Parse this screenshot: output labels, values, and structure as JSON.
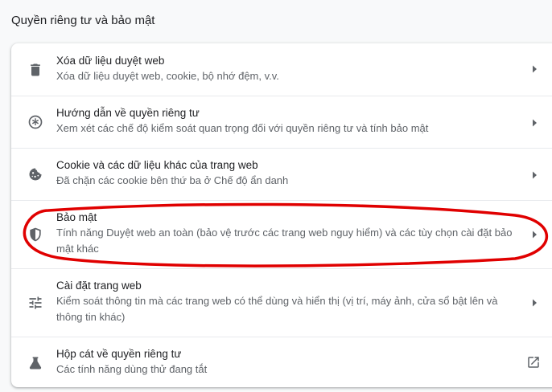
{
  "section_title": "Quyền riêng tư và bảo mật",
  "items": [
    {
      "title": "Xóa dữ liệu duyệt web",
      "description": "Xóa dữ liệu duyệt web, cookie, bộ nhớ đệm, v.v.",
      "icon": "trash-icon",
      "action": "chevron-right-icon"
    },
    {
      "title": "Hướng dẫn về quyền riêng tư",
      "description": "Xem xét các chế độ kiểm soát quan trọng đối với quyền riêng tư và tính bảo mật",
      "icon": "privacy-guide-icon",
      "action": "chevron-right-icon"
    },
    {
      "title": "Cookie và các dữ liệu khác của trang web",
      "description": "Đã chặn các cookie bên thứ ba ở Chế độ ẩn danh",
      "icon": "cookie-icon",
      "action": "chevron-right-icon"
    },
    {
      "title": "Bảo mật",
      "description": "Tính năng Duyệt web an toàn (bảo vệ trước các trang web nguy hiểm) và các tùy chọn cài đặt bảo mật khác",
      "icon": "shield-icon",
      "action": "chevron-right-icon"
    },
    {
      "title": "Cài đặt trang web",
      "description": "Kiểm soát thông tin mà các trang web có thể dùng và hiển thị (vị trí, máy ảnh, cửa sổ bật lên và thông tin khác)",
      "icon": "tune-icon",
      "action": "chevron-right-icon"
    },
    {
      "title": "Hộp cát về quyền riêng tư",
      "description": "Các tính năng dùng thử đang tắt",
      "icon": "flask-icon",
      "action": "open-external-icon"
    }
  ],
  "colors": {
    "background": "#f8f9fa",
    "card": "#ffffff",
    "icon": "#5f6368",
    "annotation": "#e00000"
  }
}
